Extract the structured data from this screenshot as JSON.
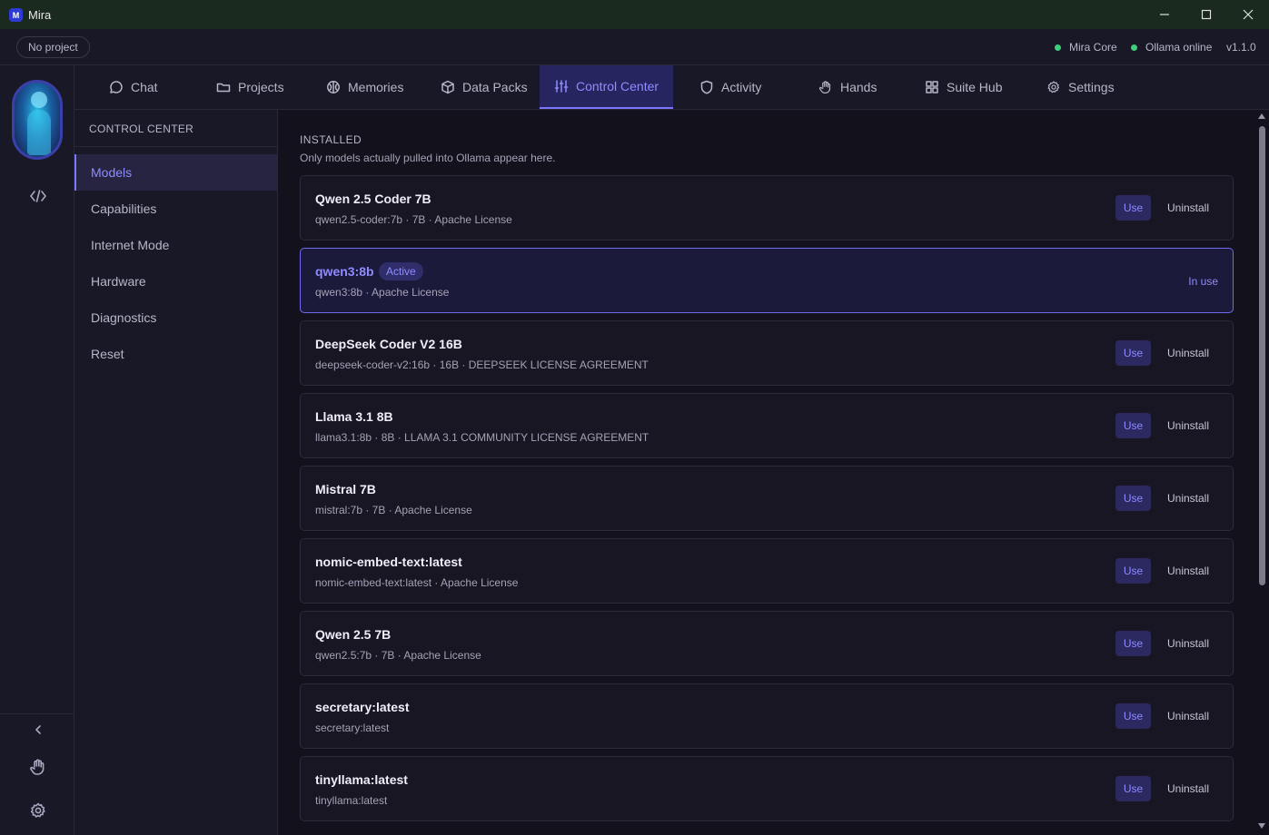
{
  "window": {
    "title": "Mira",
    "logo_glyph": "M",
    "controls": [
      "minimize-icon",
      "maximize-icon",
      "close-icon"
    ]
  },
  "statusbar": {
    "project": "No project",
    "core_status": "Mira Core",
    "ollama_status": "Ollama online",
    "version": "v1.1.0",
    "status_color": "#3ecf7a"
  },
  "rail": {
    "icons": [
      "avatar",
      "code-icon",
      "chevron-left-icon",
      "hand-icon",
      "gear-icon"
    ]
  },
  "nav": {
    "tabs": [
      {
        "label": "Chat",
        "icon": "chat-bubble-icon"
      },
      {
        "label": "Projects",
        "icon": "folder-icon"
      },
      {
        "label": "Memories",
        "icon": "brain-icon"
      },
      {
        "label": "Data Packs",
        "icon": "box-icon"
      },
      {
        "label": "Control Center",
        "icon": "sliders-icon",
        "active": true
      },
      {
        "label": "Activity",
        "icon": "shield-icon"
      },
      {
        "label": "Hands",
        "icon": "hand-icon"
      },
      {
        "label": "Suite Hub",
        "icon": "grid-icon"
      },
      {
        "label": "Settings",
        "icon": "gear-icon"
      }
    ]
  },
  "sidebar": {
    "title": "CONTROL CENTER",
    "items": [
      {
        "label": "Models",
        "active": true
      },
      {
        "label": "Capabilities"
      },
      {
        "label": "Internet Mode"
      },
      {
        "label": "Hardware"
      },
      {
        "label": "Diagnostics"
      },
      {
        "label": "Reset"
      }
    ]
  },
  "main": {
    "section_title": "INSTALLED",
    "section_subtitle": "Only models actually pulled into Ollama appear here.",
    "use_label": "Use",
    "uninstall_label": "Uninstall",
    "active_badge": "Active",
    "in_use_label": "In use",
    "accent_color": "#8f8cff",
    "models": [
      {
        "name": "Qwen 2.5 Coder 7B",
        "meta": "qwen2.5-coder:7b · 7B · Apache License"
      },
      {
        "name": "qwen3:8b",
        "meta": "qwen3:8b · Apache License",
        "active": true
      },
      {
        "name": "DeepSeek Coder V2 16B",
        "meta": "deepseek-coder-v2:16b · 16B · DEEPSEEK LICENSE AGREEMENT"
      },
      {
        "name": "Llama 3.1 8B",
        "meta": "llama3.1:8b · 8B · LLAMA 3.1 COMMUNITY LICENSE AGREEMENT"
      },
      {
        "name": "Mistral 7B",
        "meta": "mistral:7b · 7B · Apache License"
      },
      {
        "name": "nomic-embed-text:latest",
        "meta": "nomic-embed-text:latest · Apache License"
      },
      {
        "name": "Qwen 2.5 7B",
        "meta": "qwen2.5:7b · 7B · Apache License"
      },
      {
        "name": "secretary:latest",
        "meta": "secretary:latest"
      },
      {
        "name": "tinyllama:latest",
        "meta": "tinyllama:latest"
      }
    ]
  }
}
